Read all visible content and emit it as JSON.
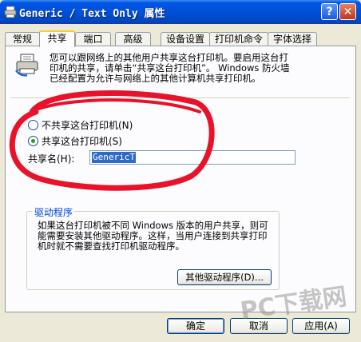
{
  "window": {
    "title": "Generic / Text Only 属性",
    "help_label": "?",
    "close_label": "✕"
  },
  "tabs": [
    {
      "label": "常规"
    },
    {
      "label": "共享"
    },
    {
      "label": "端口"
    },
    {
      "label": "高级"
    },
    {
      "label": "设备设置"
    },
    {
      "label": "打印机命令"
    },
    {
      "label": "字体选择"
    }
  ],
  "sharing": {
    "info_text": "您可以跟网络上的其他用户共享这台打印机。要启用这台打印机的共享，请单击“共享这台打印机”。 Windows 防火墙已经配置为允许与网络上的其他计算机共享打印机。",
    "radio_no_share": "不共享这台打印机(N)",
    "radio_share": "共享这台打印机(S)",
    "share_name_label": "共享名(H):",
    "share_name_value": "GenericT"
  },
  "drivers": {
    "title": "驱动程序",
    "text": "如果这台打印机被不同 Windows 版本的用户共享，则可能需要安装其他驱动程序。这样，当用户连接到共享打印机时就不需要查找打印机驱动程序。",
    "other_drivers_button": "其他驱动程序(D)..."
  },
  "footer": {
    "ok": "确定",
    "cancel": "取消",
    "apply": "应用(A)"
  },
  "watermark": "PC下载网",
  "colors": {
    "titlebar": "#0050D8",
    "dialog_bg": "#ECE9D8",
    "annotation": "#E8122A"
  }
}
